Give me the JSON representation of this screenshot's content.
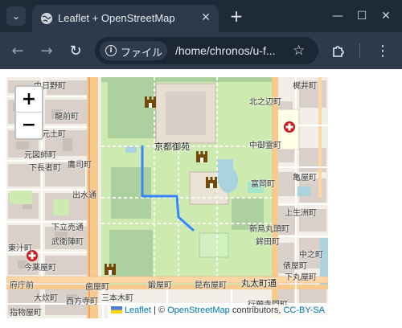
{
  "browser": {
    "tab": {
      "title": "Leaflet + OpenStreetMap",
      "favicon": "globe-icon"
    },
    "site_chip": "ファイル",
    "url": "/home/chronos/u-f...",
    "icons": [
      "chevron-down-icon",
      "close-icon",
      "plus-icon",
      "minimize-icon",
      "maximize-icon",
      "window-close-icon",
      "back-arrow-icon",
      "forward-arrow-icon",
      "reload-icon",
      "info-icon",
      "star-icon",
      "extensions-icon",
      "kebab-menu-icon"
    ],
    "colors": {
      "frame": "#1f2a38",
      "toolbar": "#2c3a4c",
      "omnibox": "#1c2735"
    }
  },
  "map": {
    "zoom_in": "+",
    "zoom_out": "−",
    "route_color": "#3388ff",
    "labels": {
      "l1": "中日野町",
      "l2": "龍前町",
      "l3": "元土町",
      "l4": "元図師町",
      "l5": "下長者町",
      "l6": "鷹司町",
      "l7": "出水通",
      "l8": "下立売通",
      "l9": "武衛陣町",
      "l10": "東汁町",
      "l11": "今薬屋町",
      "l12": "府庁前",
      "l13": "大炊町",
      "l14": "西方寺町",
      "l15": "指物屋町",
      "l16": "京都御苑",
      "l17": "梶井町",
      "l18": "北之辺町",
      "l19": "中御霊町",
      "l20": "亀屋町",
      "l21": "上生洲町",
      "l22": "新烏丸頭町",
      "l23": "下丸屋町",
      "l24": "丸太町通",
      "l25": "鍛屋町",
      "l26": "昆布屋町",
      "l27": "行願寺門町",
      "l28": "俵屋町",
      "l29": "中之町",
      "l30": "鉾田町",
      "l31": "歯屋町",
      "l32": "富岡町",
      "l33": "三本木町"
    },
    "attribution": {
      "leaflet": "Leaflet",
      "sep": "|",
      "copy": "©",
      "osm": "OpenStreetMap",
      "contrib": "contributors,",
      "license": "CC-BY-SA"
    },
    "icons": [
      "flag-icon",
      "castle-icon",
      "hospital-icon"
    ]
  }
}
